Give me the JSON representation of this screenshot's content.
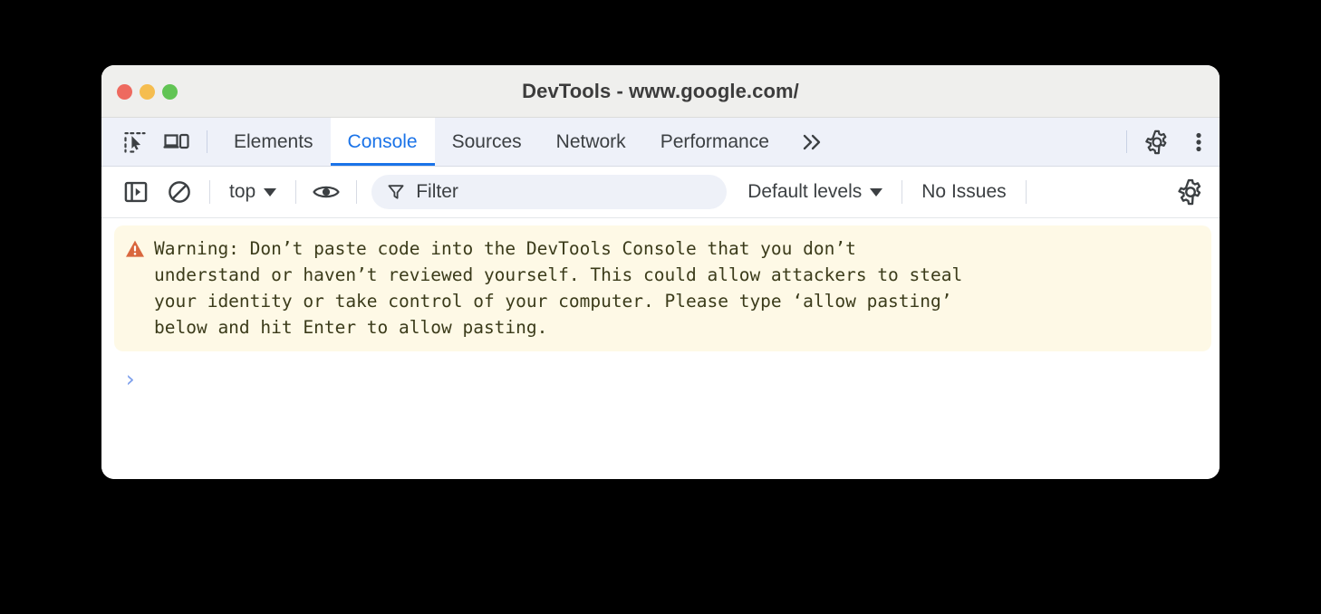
{
  "window": {
    "title": "DevTools - www.google.com/",
    "traffic_lights": [
      {
        "name": "close",
        "color": "#ee6a5f"
      },
      {
        "name": "minimize",
        "color": "#f5bd4f"
      },
      {
        "name": "zoom",
        "color": "#61c454"
      }
    ]
  },
  "tabbar": {
    "inspect_icon": "inspect-element-icon",
    "device_icon": "device-toolbar-icon",
    "tabs": [
      {
        "label": "Elements",
        "active": false
      },
      {
        "label": "Console",
        "active": true
      },
      {
        "label": "Sources",
        "active": false
      },
      {
        "label": "Network",
        "active": false
      },
      {
        "label": "Performance",
        "active": false
      }
    ],
    "overflow_label": "»",
    "settings_icon": "gear-icon",
    "more_icon": "three-dots-vertical-icon"
  },
  "console_toolbar": {
    "sidebar_toggle_icon": "console-sidebar-icon",
    "clear_icon": "clear-console-icon",
    "context_selector": "top",
    "eye_icon": "live-expression-eye-icon",
    "filter": {
      "icon": "filter-funnel-icon",
      "placeholder": "Filter",
      "value": ""
    },
    "levels_label": "Default levels",
    "issues_label": "No Issues",
    "settings_icon": "gear-icon"
  },
  "console": {
    "warning": {
      "icon": "warning-triangle-icon",
      "icon_color": "#d9673e",
      "background": "#fef9e6",
      "text": "Warning: Don’t paste code into the DevTools Console that you don’t\nunderstand or haven’t reviewed yourself. This could allow attackers to steal\nyour identity or take control of your computer. Please type ‘allow pasting’\nbelow and hit Enter to allow pasting."
    },
    "prompt_caret": "›",
    "prompt_value": ""
  },
  "colors": {
    "accent_blue": "#1a73e8",
    "tabbar_bg": "#eef1f9",
    "titlebar_bg": "#efefed",
    "warning_bg": "#fef9e6",
    "prompt_blue": "#7ea0ec"
  }
}
